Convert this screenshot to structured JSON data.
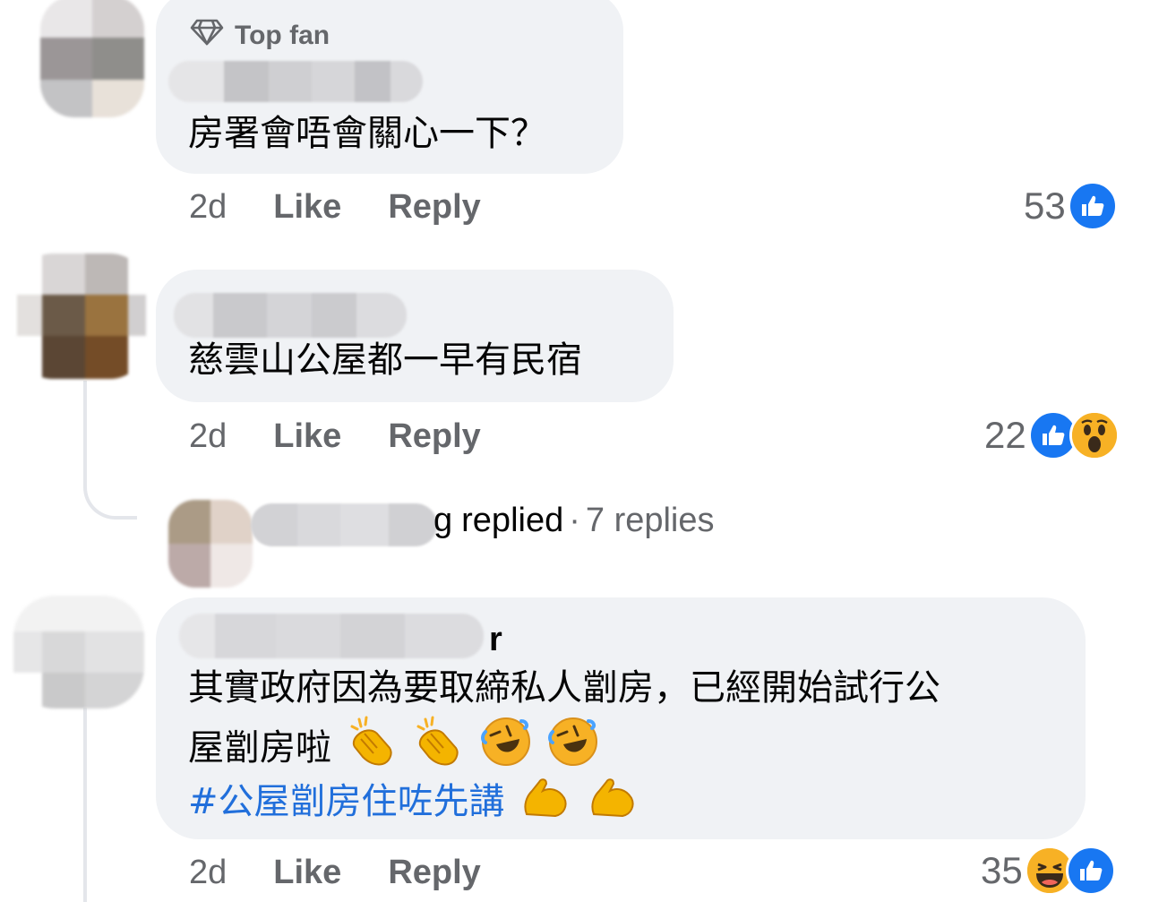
{
  "comments": [
    {
      "badge": "Top fan",
      "text_lines": [
        "房署會唔會關心一下？"
      ],
      "time": "2d",
      "like_label": "Like",
      "reply_label": "Reply",
      "reaction_count": "53",
      "reactions": [
        "like"
      ]
    },
    {
      "text_lines": [
        "慈雲山公屋都一早有民宿"
      ],
      "time": "2d",
      "like_label": "Like",
      "reply_label": "Reply",
      "reaction_count": "22",
      "reactions": [
        "like",
        "wow"
      ],
      "replies": {
        "author_suffix": "g",
        "action": "replied",
        "separator": "·",
        "count_label": "7 replies"
      }
    },
    {
      "author_suffix": "r",
      "text_lines": [
        "其實政府因為要取締私人劏房，已經開始試行公",
        "屋劏房啦"
      ],
      "emoji_line2": [
        "clap",
        "clap",
        "rofl",
        "rofl"
      ],
      "hashtag": "#公屋劏房住咗先講",
      "emoji_line3": [
        "muscle",
        "muscle"
      ],
      "time": "2d",
      "like_label": "Like",
      "reply_label": "Reply",
      "reaction_count": "35",
      "reactions": [
        "haha",
        "like"
      ]
    }
  ],
  "colors": {
    "bubble": "#f0f2f5",
    "meta_text": "#65676b",
    "like_blue": "#1877f2",
    "hashtag_blue": "#216fdb",
    "emoji_yellow": "#f7b125"
  }
}
